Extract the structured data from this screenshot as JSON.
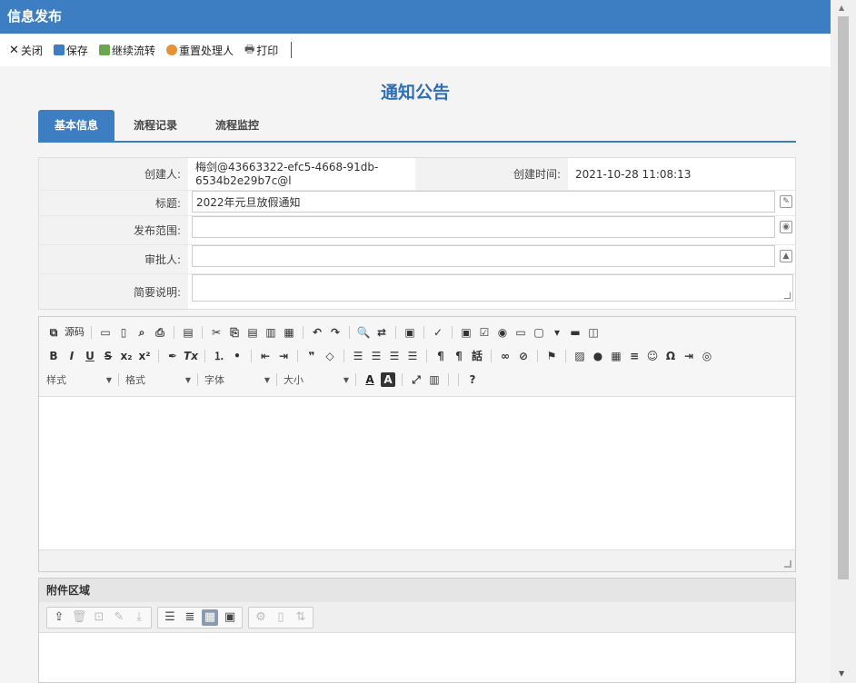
{
  "window": {
    "title": "信息发布"
  },
  "toolbar": {
    "close": "关闭",
    "save": "保存",
    "continue": "继续流转",
    "reset_handler": "重置处理人",
    "print": "打印"
  },
  "page": {
    "title": "通知公告"
  },
  "tabs": [
    "基本信息",
    "流程记录",
    "流程监控"
  ],
  "form": {
    "creator_label": "创建人:",
    "creator_value": "梅剑@43663322-efc5-4668-91db-6534b2e29b7c@l",
    "created_time_label": "创建时间:",
    "created_time_value": "2021-10-28 11:08:13",
    "title_label": "标题:",
    "title_value": "2022年元旦放假通知",
    "scope_label": "发布范围:",
    "scope_value": "",
    "approver_label": "审批人:",
    "approver_value": "",
    "summary_label": "简要说明:",
    "summary_value": ""
  },
  "editor": {
    "source_label": "源码",
    "combos": [
      "样式",
      "格式",
      "字体",
      "大小"
    ],
    "help": "?"
  },
  "attachments": {
    "title": "附件区域"
  }
}
